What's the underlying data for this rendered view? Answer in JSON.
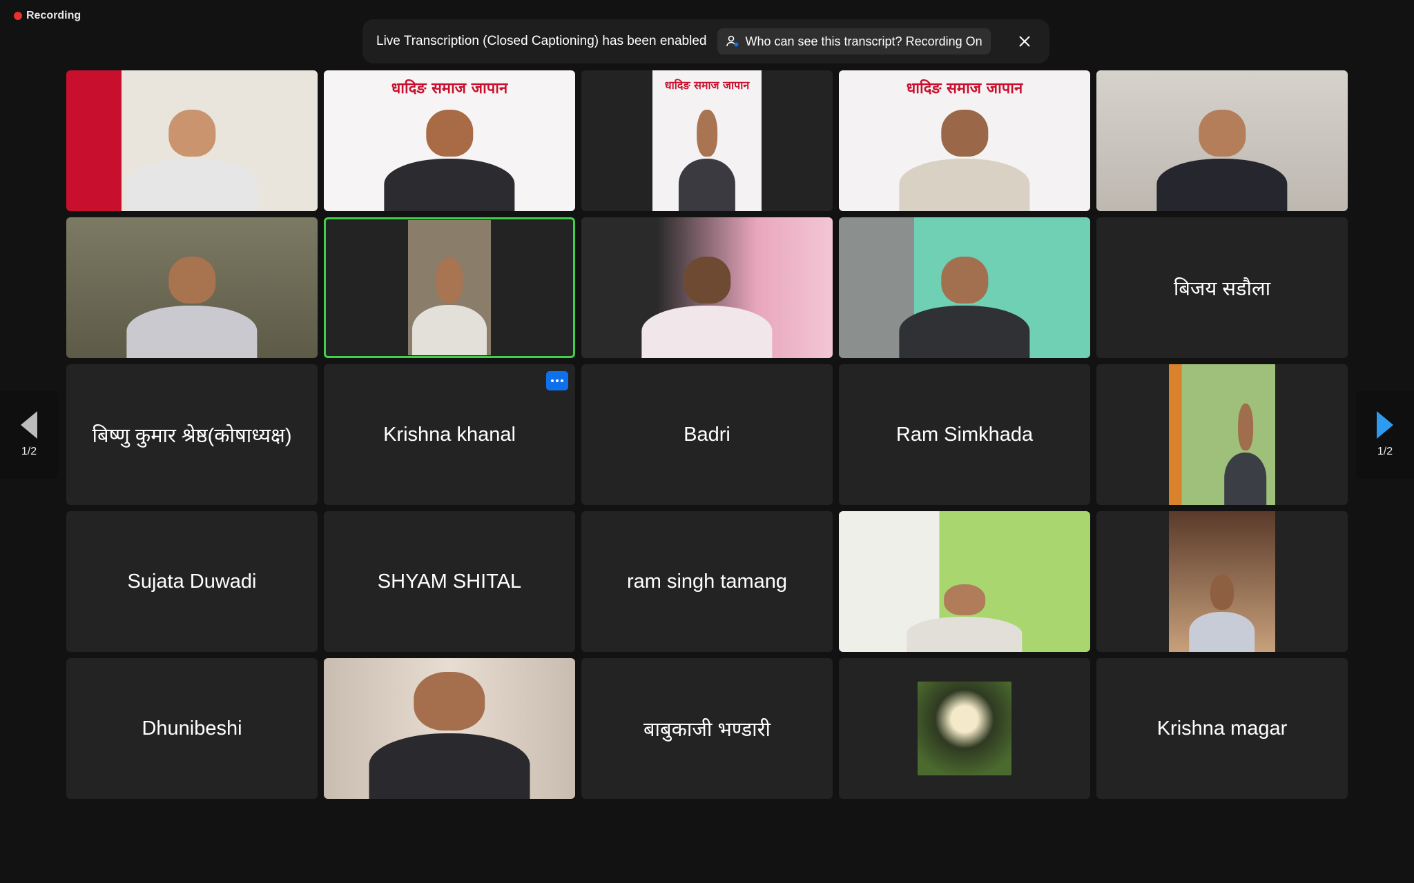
{
  "recording": {
    "label": "Recording"
  },
  "banner": {
    "message": "Live Transcription (Closed Captioning) has been enabled",
    "info_button": "Who can see this transcript? Recording On"
  },
  "pager": {
    "left_page": "1/2",
    "right_page": "1/2"
  },
  "tiles": [
    {
      "poster": ""
    },
    {
      "poster": "धादिङ समाज जापान"
    },
    {
      "poster": "धादिङ समाज जापान"
    },
    {
      "poster": "धादिङ समाज जापान"
    },
    {
      "poster": ""
    },
    {
      "poster": ""
    },
    {
      "poster": ""
    },
    {
      "poster": ""
    },
    {
      "poster": ""
    },
    {
      "name": "बिजय सडौला"
    },
    {
      "name": "बिष्णु कुमार श्रेष्ठ(कोषाध्यक्ष)"
    },
    {
      "name": "Krishna khanal"
    },
    {
      "name": "Badri"
    },
    {
      "name": "Ram Simkhada"
    },
    {
      "poster": ""
    },
    {
      "name": "Sujata Duwadi"
    },
    {
      "name": "SHYAM SHITAL"
    },
    {
      "name": "ram singh tamang"
    },
    {
      "poster": ""
    },
    {
      "poster": ""
    },
    {
      "name": "Dhunibeshi"
    },
    {
      "poster": ""
    },
    {
      "name": "बाबुकाजी भण्डारी"
    },
    {
      "poster": ""
    },
    {
      "name": "Krishna magar"
    }
  ],
  "colors": {
    "background": "#121212",
    "tile": "#232323",
    "active_speaker": "#40d14b",
    "accent_blue": "#0e71eb",
    "recording_red": "#e5322d"
  }
}
